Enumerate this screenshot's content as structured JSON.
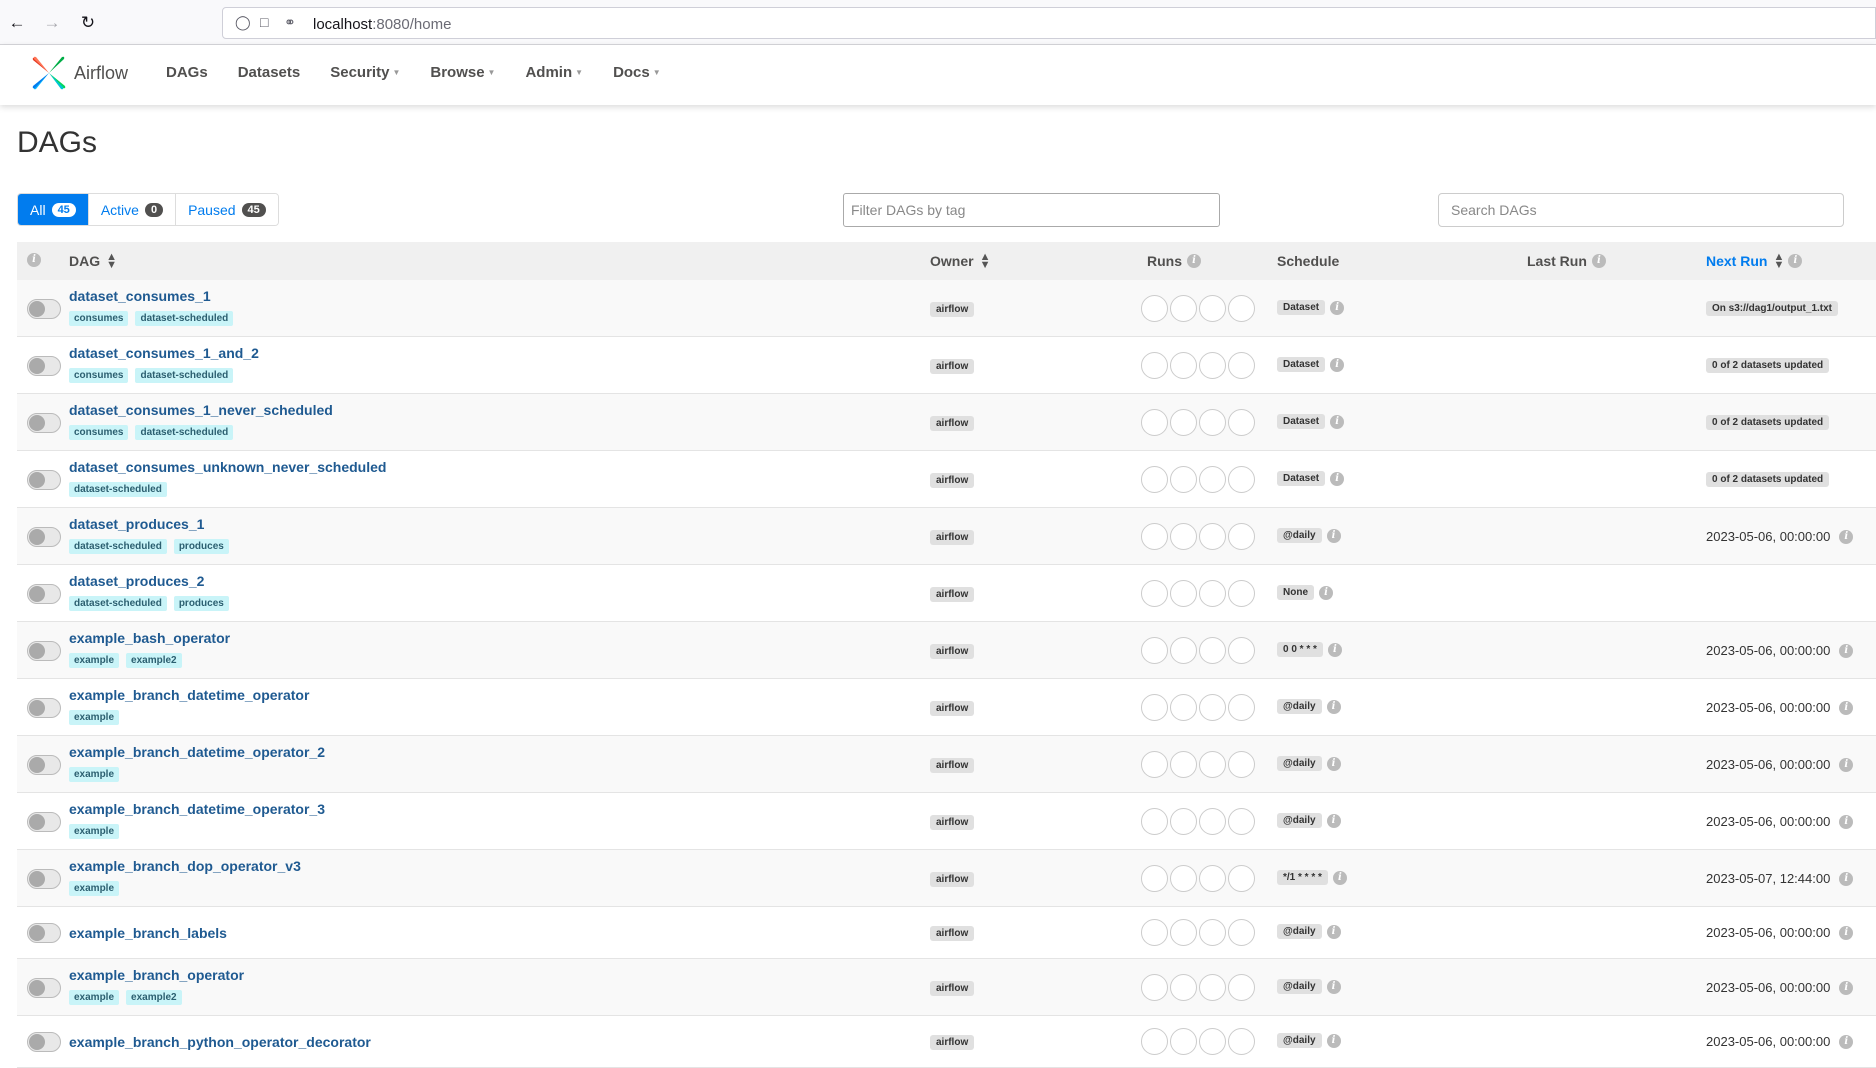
{
  "browser": {
    "url_host": "localhost",
    "url_path": ":8080/home"
  },
  "navbar": {
    "brand": "Airflow",
    "items": [
      {
        "label": "DAGs",
        "dropdown": false
      },
      {
        "label": "Datasets",
        "dropdown": false
      },
      {
        "label": "Security",
        "dropdown": true
      },
      {
        "label": "Browse",
        "dropdown": true
      },
      {
        "label": "Admin",
        "dropdown": true
      },
      {
        "label": "Docs",
        "dropdown": true
      }
    ]
  },
  "page": {
    "title": "DAGs",
    "status_tabs": [
      {
        "label": "All",
        "count": "45",
        "active": true
      },
      {
        "label": "Active",
        "count": "0",
        "active": false
      },
      {
        "label": "Paused",
        "count": "45",
        "active": false
      }
    ],
    "tag_filter_placeholder": "Filter DAGs by tag",
    "search_placeholder": "Search DAGs"
  },
  "table": {
    "headers": {
      "dag": "DAG",
      "owner": "Owner",
      "runs": "Runs",
      "schedule": "Schedule",
      "last_run": "Last Run",
      "next_run": "Next Run"
    },
    "rows": [
      {
        "name": "dataset_consumes_1",
        "tags": [
          "consumes",
          "dataset-scheduled"
        ],
        "owner": "airflow",
        "schedule": "Dataset",
        "next_run": "On s3://dag1/output_1.txt",
        "next_run_badge": true
      },
      {
        "name": "dataset_consumes_1_and_2",
        "tags": [
          "consumes",
          "dataset-scheduled"
        ],
        "owner": "airflow",
        "schedule": "Dataset",
        "next_run": "0 of 2 datasets updated",
        "next_run_badge": true
      },
      {
        "name": "dataset_consumes_1_never_scheduled",
        "tags": [
          "consumes",
          "dataset-scheduled"
        ],
        "owner": "airflow",
        "schedule": "Dataset",
        "next_run": "0 of 2 datasets updated",
        "next_run_badge": true
      },
      {
        "name": "dataset_consumes_unknown_never_scheduled",
        "tags": [
          "dataset-scheduled"
        ],
        "owner": "airflow",
        "schedule": "Dataset",
        "next_run": "0 of 2 datasets updated",
        "next_run_badge": true
      },
      {
        "name": "dataset_produces_1",
        "tags": [
          "dataset-scheduled",
          "produces"
        ],
        "owner": "airflow",
        "schedule": "@daily",
        "next_run": "2023-05-06, 00:00:00",
        "next_run_badge": false
      },
      {
        "name": "dataset_produces_2",
        "tags": [
          "dataset-scheduled",
          "produces"
        ],
        "owner": "airflow",
        "schedule": "None",
        "next_run": "",
        "next_run_badge": false
      },
      {
        "name": "example_bash_operator",
        "tags": [
          "example",
          "example2"
        ],
        "owner": "airflow",
        "schedule": "0 0 * * *",
        "next_run": "2023-05-06, 00:00:00",
        "next_run_badge": false
      },
      {
        "name": "example_branch_datetime_operator",
        "tags": [
          "example"
        ],
        "owner": "airflow",
        "schedule": "@daily",
        "next_run": "2023-05-06, 00:00:00",
        "next_run_badge": false
      },
      {
        "name": "example_branch_datetime_operator_2",
        "tags": [
          "example"
        ],
        "owner": "airflow",
        "schedule": "@daily",
        "next_run": "2023-05-06, 00:00:00",
        "next_run_badge": false
      },
      {
        "name": "example_branch_datetime_operator_3",
        "tags": [
          "example"
        ],
        "owner": "airflow",
        "schedule": "@daily",
        "next_run": "2023-05-06, 00:00:00",
        "next_run_badge": false
      },
      {
        "name": "example_branch_dop_operator_v3",
        "tags": [
          "example"
        ],
        "owner": "airflow",
        "schedule": "*/1 * * * *",
        "next_run": "2023-05-07, 12:44:00",
        "next_run_badge": false
      },
      {
        "name": "example_branch_labels",
        "tags": [],
        "owner": "airflow",
        "schedule": "@daily",
        "next_run": "2023-05-06, 00:00:00",
        "next_run_badge": false
      },
      {
        "name": "example_branch_operator",
        "tags": [
          "example",
          "example2"
        ],
        "owner": "airflow",
        "schedule": "@daily",
        "next_run": "2023-05-06, 00:00:00",
        "next_run_badge": false
      },
      {
        "name": "example_branch_python_operator_decorator",
        "tags": [],
        "owner": "airflow",
        "schedule": "@daily",
        "next_run": "2023-05-06, 00:00:00",
        "next_run_badge": false
      }
    ]
  },
  "colors": {
    "accent": "#017cee",
    "dag_link": "#1f5a91",
    "tag_bg": "#c9f4f8"
  }
}
